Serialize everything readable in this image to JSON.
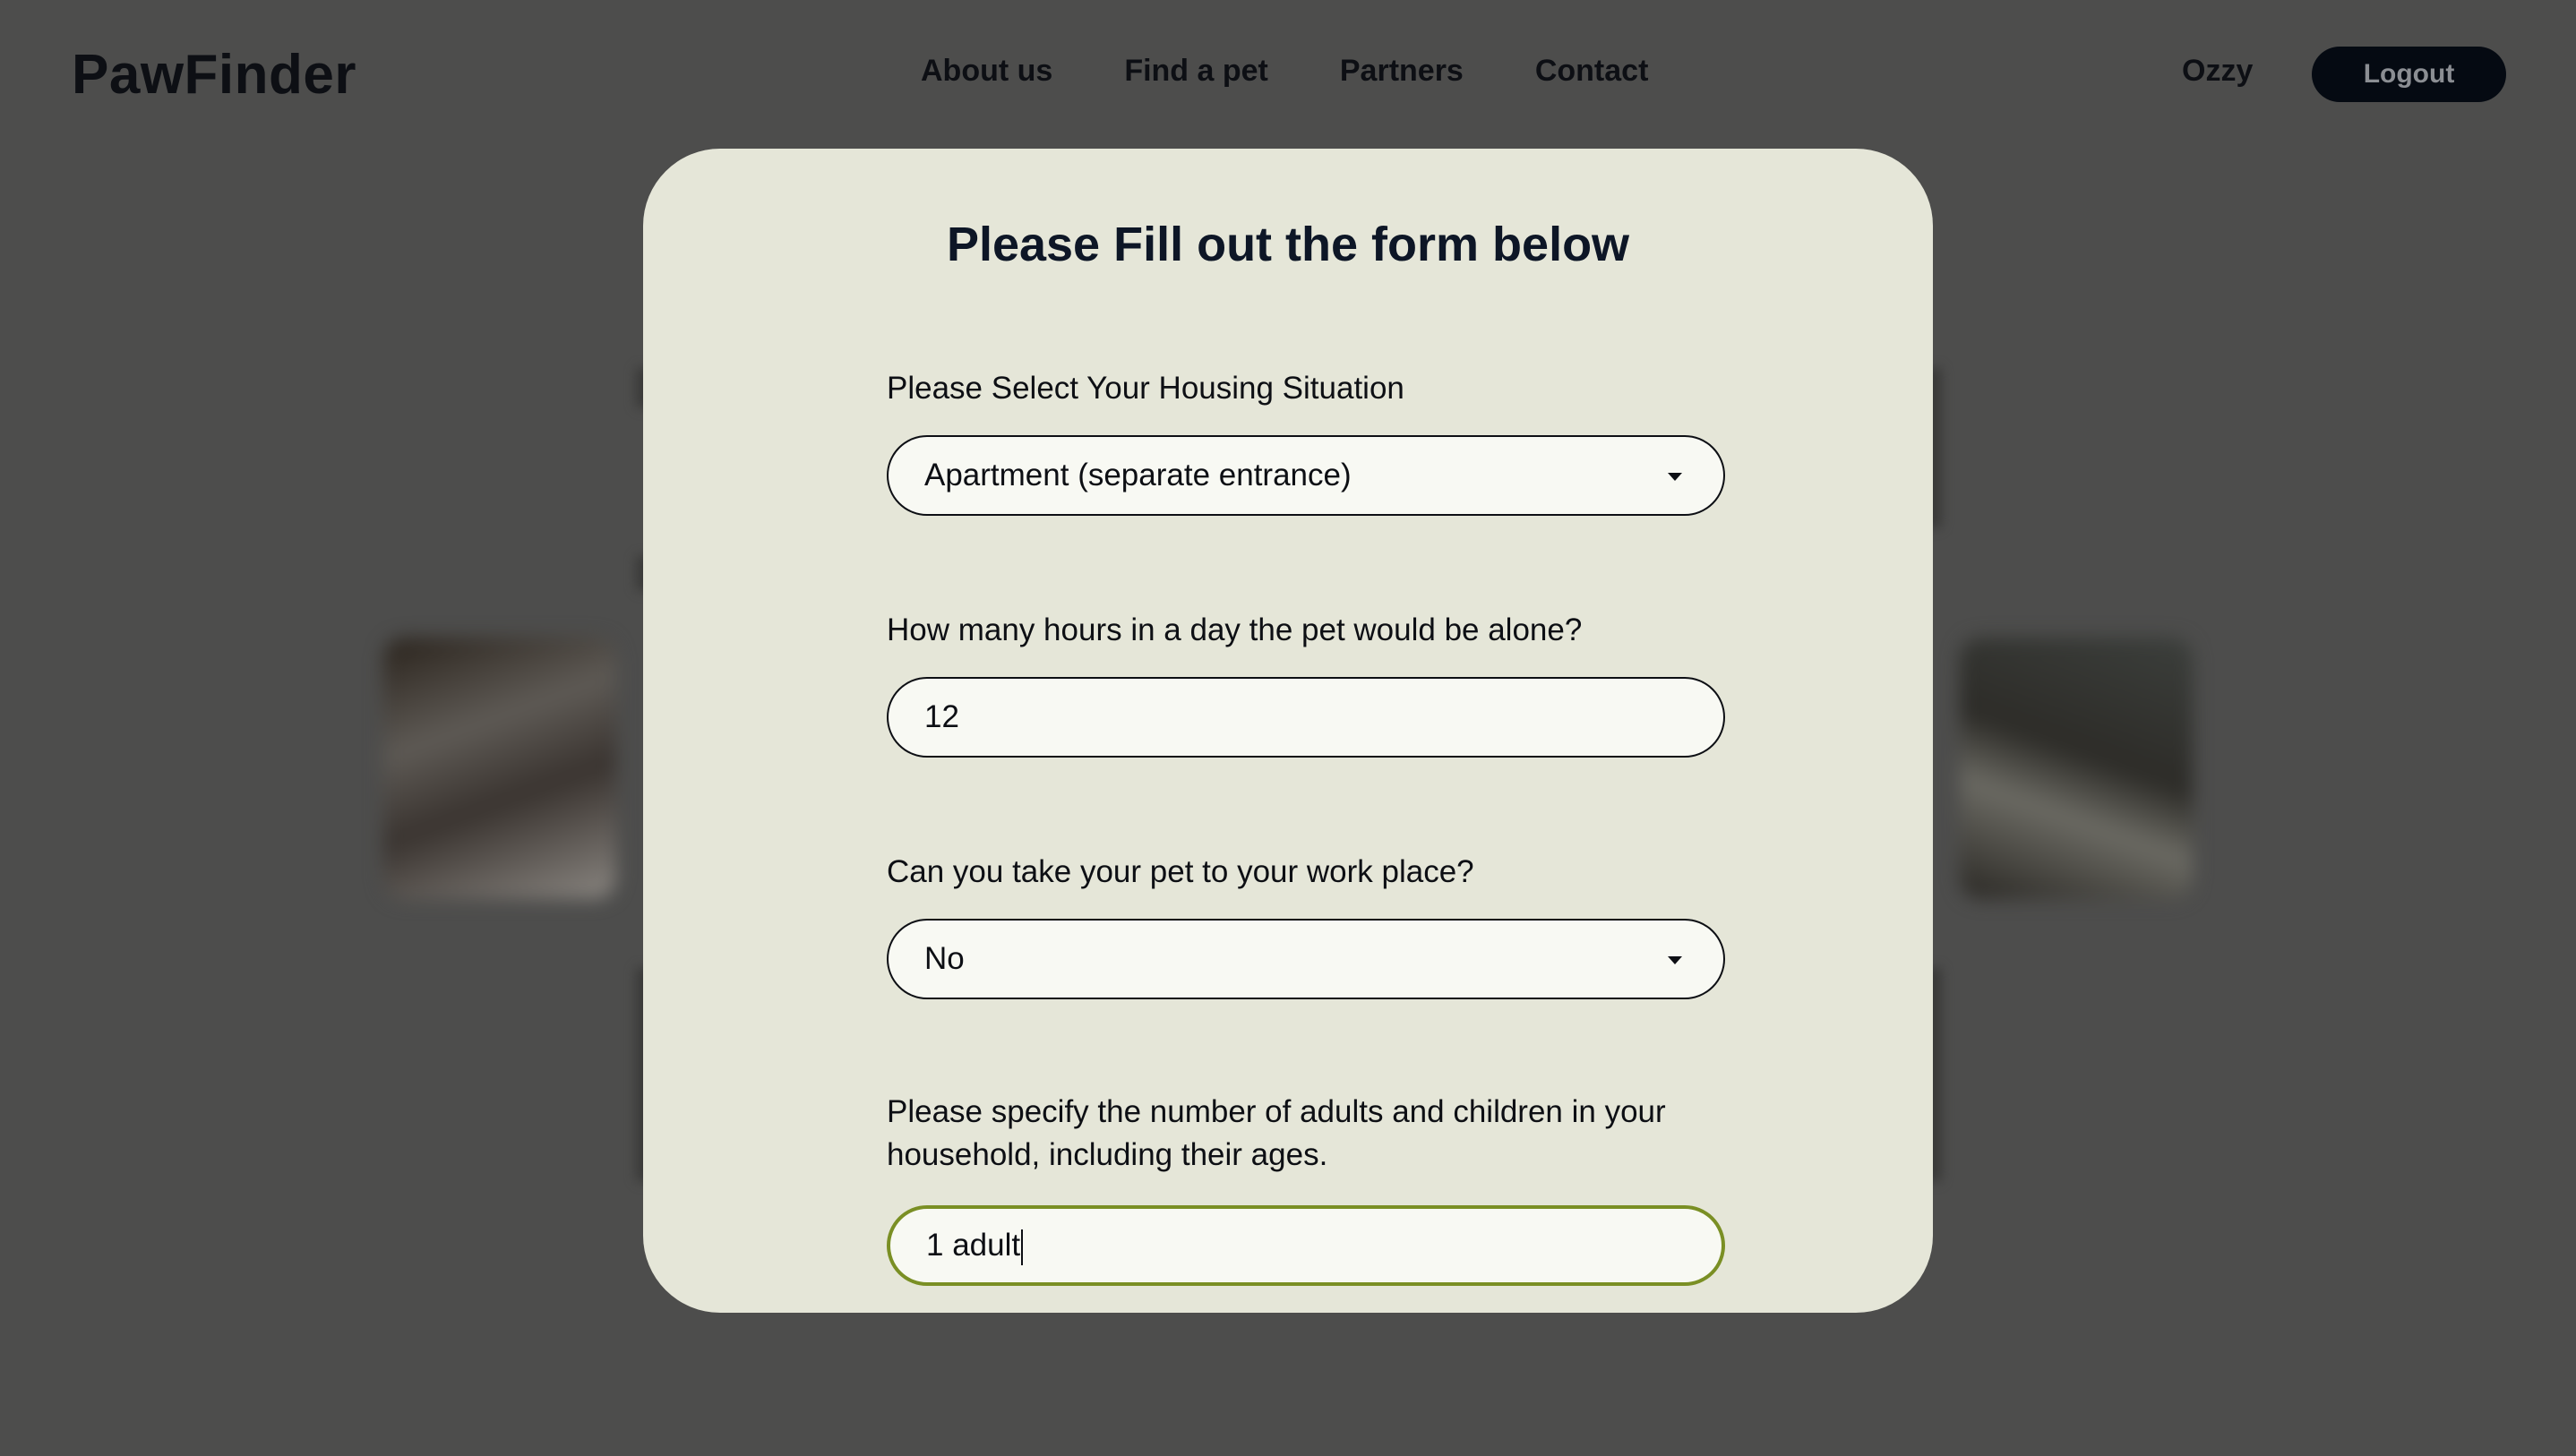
{
  "header": {
    "logo": "PawFinder",
    "nav": [
      {
        "label": "About us"
      },
      {
        "label": "Find a pet"
      },
      {
        "label": "Partners"
      },
      {
        "label": "Contact"
      }
    ],
    "user_name": "Ozzy",
    "logout_label": "Logout"
  },
  "form": {
    "title": "Please Fill out the form below",
    "housing": {
      "label": "Please Select Your Housing Situation",
      "value": "Apartment (separate entrance)"
    },
    "hours_alone": {
      "label": "How many hours in a day the pet would be alone?",
      "value": "12"
    },
    "work_place": {
      "label": "Can you take your pet to your work place?",
      "value": "No"
    },
    "household": {
      "label": "Please specify the number of adults and children in your household, including their ages.",
      "value": "1 adult"
    }
  },
  "colors": {
    "overlay": "#4d4d4c",
    "modal_bg": "#e5e6d8",
    "field_bg": "#f8f9f3",
    "focus_border": "#7a8f24",
    "logout_bg": "#050a12"
  }
}
